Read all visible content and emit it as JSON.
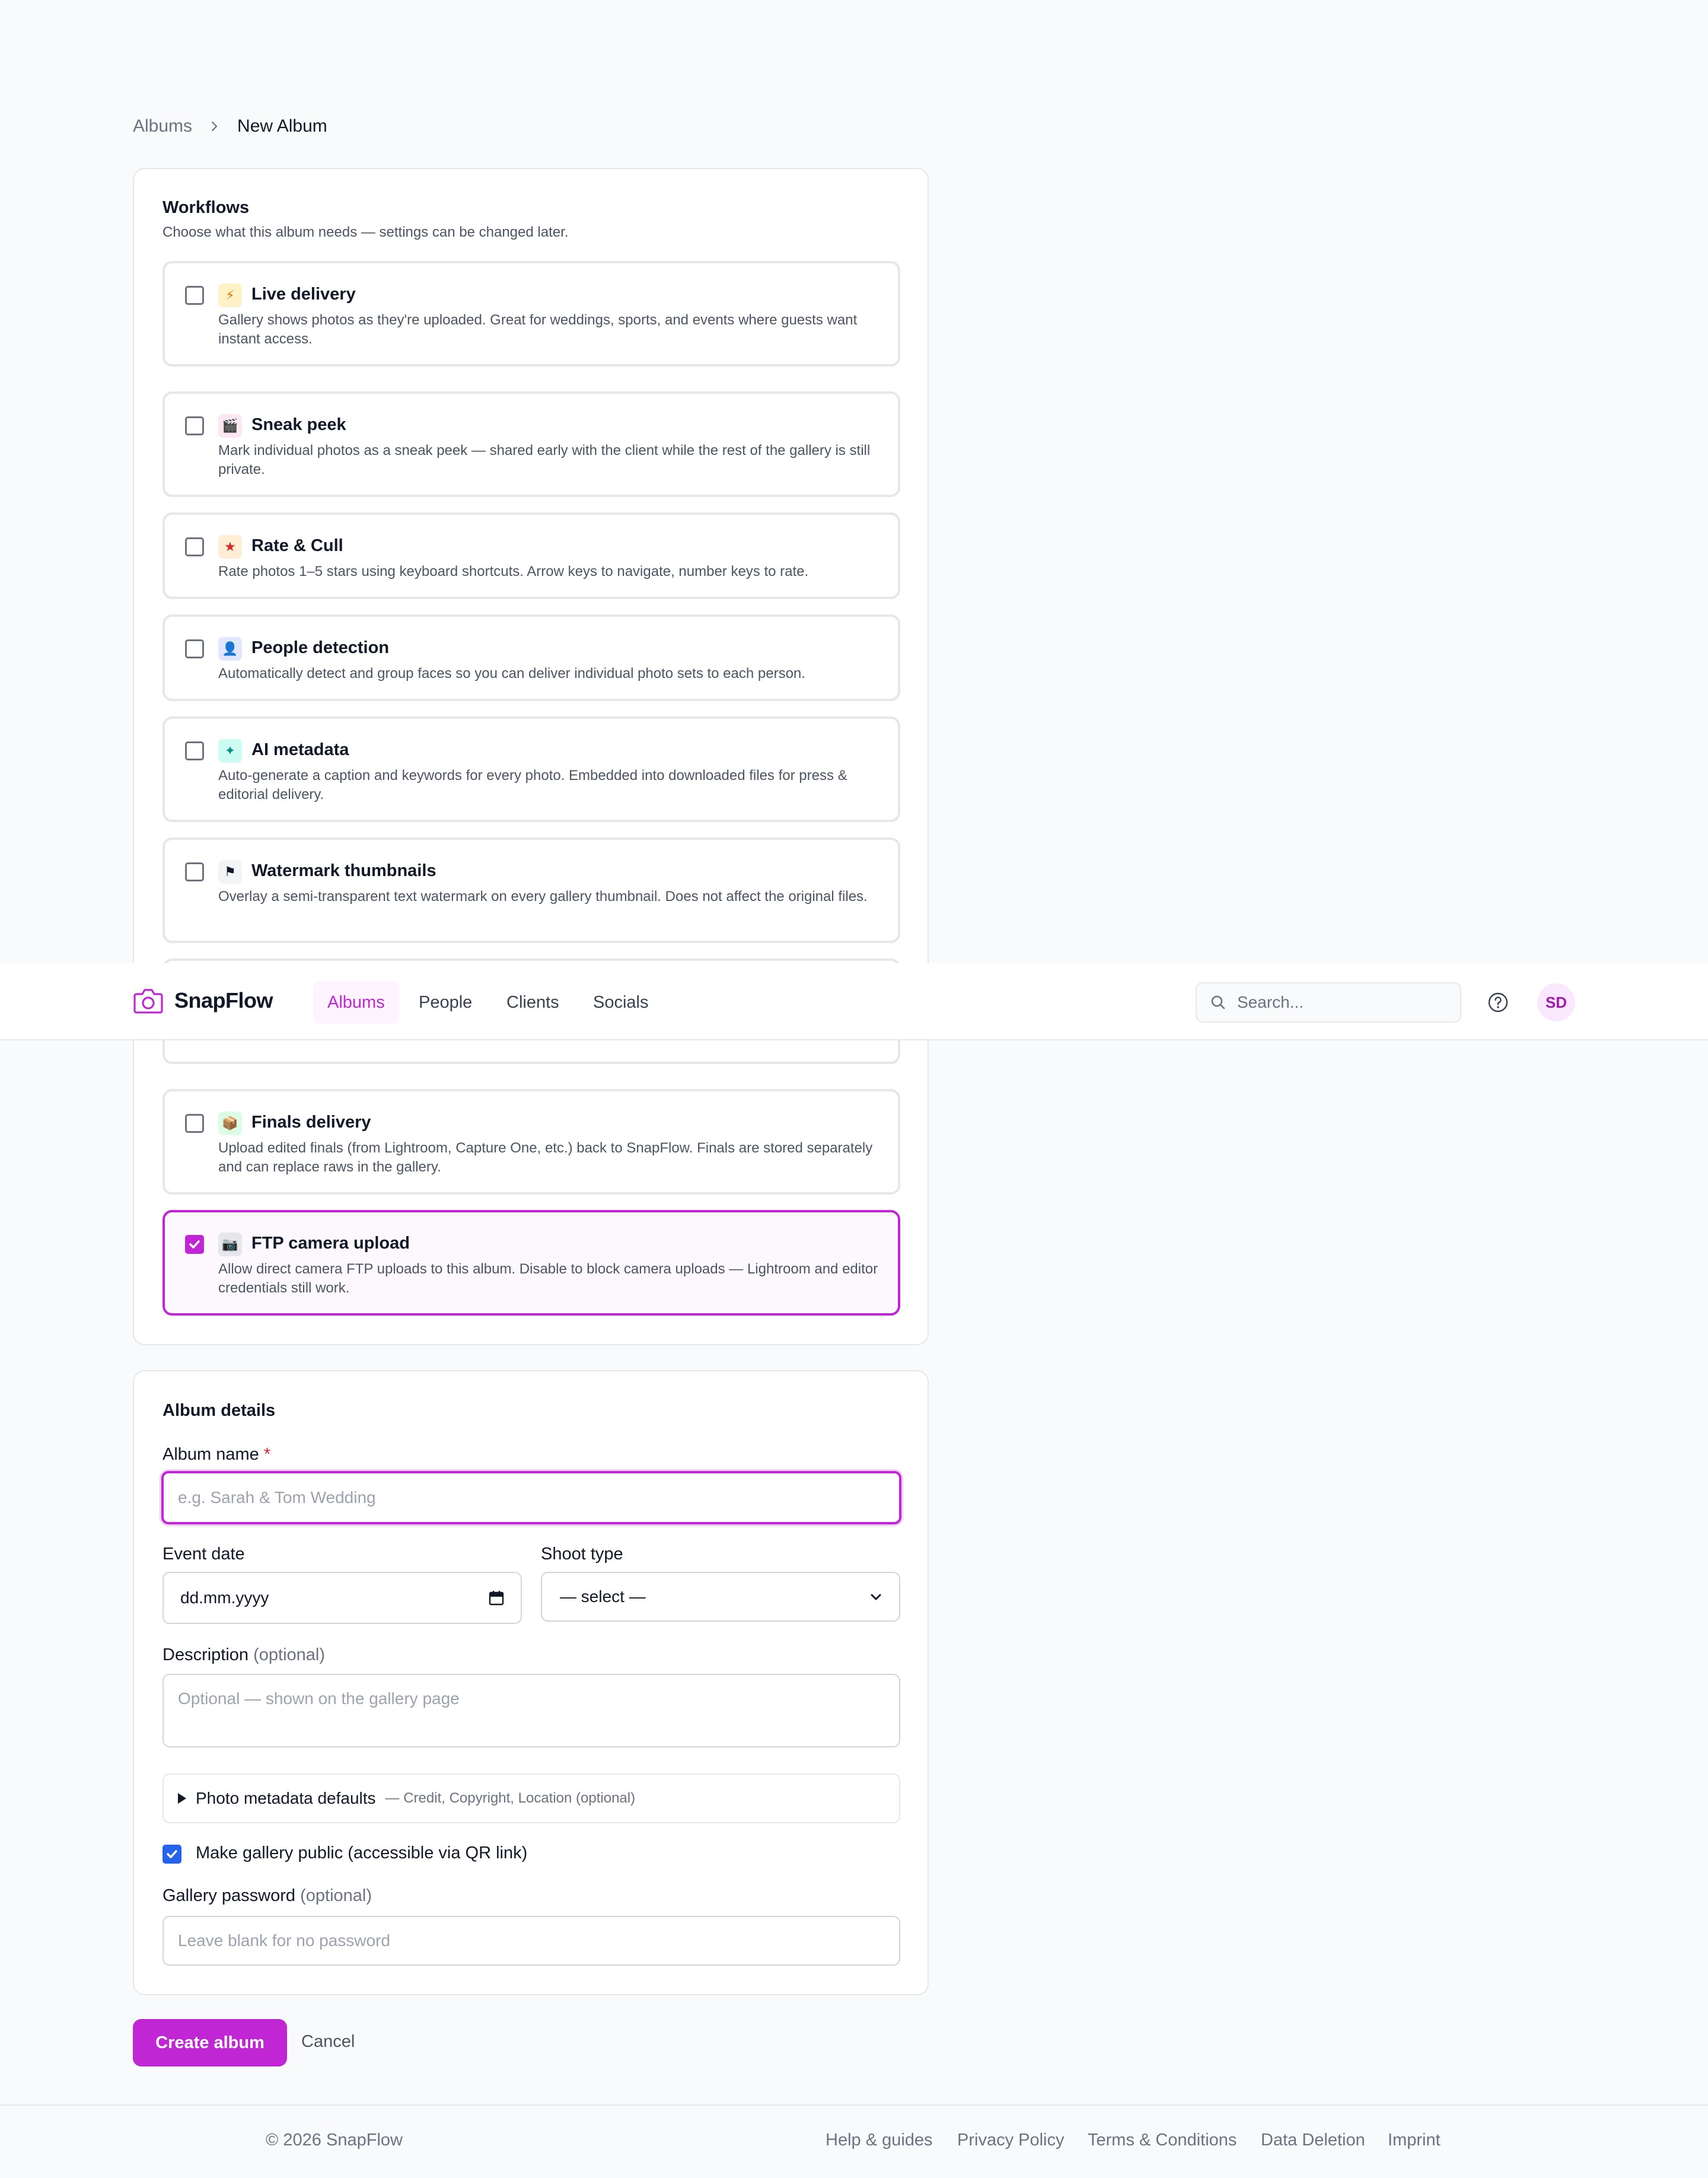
{
  "breadcrumb": {
    "parent": "Albums",
    "current": "New Album"
  },
  "workflows": {
    "title": "Workflows",
    "subtitle": "Choose what this album needs — settings can be changed later.",
    "options": [
      {
        "icon": "lightning-icon",
        "glyph": "⚡",
        "icon_bg": "#fef3c7",
        "icon_fg": "#d97706",
        "title": "Live delivery",
        "desc": "Gallery shows photos as they're uploaded. Great for weddings, sports, and events where guests want instant access.",
        "checked": false
      },
      {
        "icon": "clapper-icon",
        "glyph": "🎬",
        "icon_bg": "#fce7f3",
        "icon_fg": "#be185d",
        "title": "Sneak peek",
        "desc": "Mark individual photos as a sneak peek — shared early with the client while the rest of the gallery is still private.",
        "checked": false
      },
      {
        "icon": "star-icon",
        "glyph": "★",
        "icon_bg": "#ffedd5",
        "icon_fg": "#dc2626",
        "title": "Rate & Cull",
        "desc": "Rate photos 1–5 stars using keyboard shortcuts. Arrow keys to navigate, number keys to rate.",
        "checked": false
      },
      {
        "icon": "person-icon",
        "glyph": "👤",
        "icon_bg": "#e0e7ff",
        "icon_fg": "#4f46e5",
        "title": "People detection",
        "desc": "Automatically detect and group faces so you can deliver individual photo sets to each person.",
        "checked": false
      },
      {
        "icon": "sparkle-icon",
        "glyph": "✦",
        "icon_bg": "#ccfbf1",
        "icon_fg": "#0d9488",
        "title": "AI metadata",
        "desc": "Auto-generate a caption and keywords for every photo. Embedded into downloaded files for press & editorial delivery.",
        "checked": false
      },
      {
        "icon": "flag-icon",
        "glyph": "⚑",
        "icon_bg": "#f3f4f6",
        "icon_fg": "#111827",
        "title": "Watermark thumbnails",
        "desc": "Overlay a semi-transparent text watermark on every gallery thumbnail. Does not affect the original files.",
        "checked": false
      },
      {
        "icon": "package-icon",
        "glyph": "📦",
        "icon_bg": "#dcfce7",
        "icon_fg": "#15803d",
        "title": "Finals delivery",
        "desc": "Upload edited finals (from Lightroom, Capture One, etc.) back to SnapFlow. Finals are stored separately and can replace raws in the gallery.",
        "checked": false
      },
      {
        "icon": "camera-icon",
        "glyph": "📷",
        "icon_bg": "#e5e7eb",
        "icon_fg": "#374151",
        "title": "FTP camera upload",
        "desc": "Allow direct camera FTP uploads to this album. Disable to block camera uploads — Lightroom and editor credentials still work.",
        "checked": true
      }
    ]
  },
  "nav": {
    "brand": "SnapFlow",
    "tabs": [
      "Albums",
      "People",
      "Clients",
      "Socials"
    ],
    "active_tab": "Albums",
    "search_placeholder": "Search...",
    "avatar": "SD",
    "accent": "#c026d3"
  },
  "details": {
    "title": "Album details",
    "album_name_label": "Album name",
    "required_mark": "*",
    "album_name_placeholder": "e.g. Sarah & Tom Wedding",
    "event_date_label": "Event date",
    "event_date_value": "dd.mm.yyyy",
    "shoot_type_label": "Shoot type",
    "shoot_type_value": "— select —",
    "description_label": "Description",
    "optional": "(optional)",
    "description_placeholder": "Optional — shown on the gallery page",
    "metadata_title": "Photo metadata defaults",
    "metadata_sub": "— Credit, Copyright, Location (optional)",
    "public_label": "Make gallery public (accessible via QR link)",
    "public_checked": true,
    "password_label": "Gallery password",
    "password_placeholder": "Leave blank for no password"
  },
  "actions": {
    "create": "Create album",
    "cancel": "Cancel"
  },
  "footer": {
    "copyright": "© 2026 SnapFlow",
    "links": [
      "Help & guides",
      "Privacy Policy",
      "Terms & Conditions",
      "Data Deletion",
      "Imprint"
    ]
  }
}
